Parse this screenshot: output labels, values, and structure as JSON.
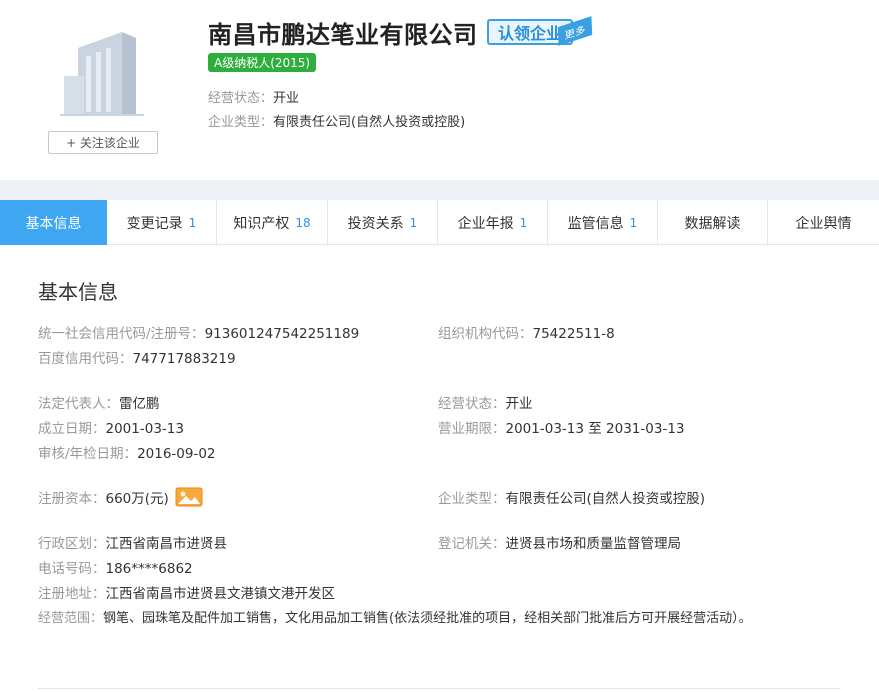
{
  "header": {
    "company_name": "南昌市鹏达笔业有限公司",
    "claim_label": "认领企业",
    "claim_tag": "更多",
    "tax_badge": "A级纳税人(2015)",
    "follow_label": "+ 关注该企业",
    "status_key": "经营状态：",
    "status_value": "开业",
    "type_key": "企业类型：",
    "type_value": "有限责任公司(自然人投资或控股)"
  },
  "tabs": [
    {
      "label": "基本信息",
      "count": ""
    },
    {
      "label": "变更记录",
      "count": "1"
    },
    {
      "label": "知识产权",
      "count": "18"
    },
    {
      "label": "投资关系",
      "count": "1"
    },
    {
      "label": "企业年报",
      "count": "1"
    },
    {
      "label": "监管信息",
      "count": "1"
    },
    {
      "label": "数据解读",
      "count": ""
    },
    {
      "label": "企业舆情",
      "count": ""
    }
  ],
  "section_title": "基本信息",
  "fields": {
    "credit_code": {
      "k": "统一社会信用代码/注册号：",
      "v": "913601247542251189"
    },
    "org_code": {
      "k": "组织机构代码：",
      "v": "75422511-8"
    },
    "baidu_code": {
      "k": "百度信用代码：",
      "v": "747717883219"
    },
    "legal_rep": {
      "k": "法定代表人：",
      "v": "雷亿鹏"
    },
    "biz_status": {
      "k": "经营状态：",
      "v": "开业"
    },
    "founded": {
      "k": "成立日期：",
      "v": "2001-03-13"
    },
    "term": {
      "k": "营业期限：",
      "v": "2001-03-13 至 2031-03-13"
    },
    "approved": {
      "k": "审核/年检日期：",
      "v": "2016-09-02"
    },
    "capital": {
      "k": "注册资本：",
      "v": "660万(元)"
    },
    "ent_type": {
      "k": "企业类型：",
      "v": "有限责任公司(自然人投资或控股)"
    },
    "region": {
      "k": "行政区划：",
      "v": "江西省南昌市进贤县"
    },
    "authority": {
      "k": "登记机关：",
      "v": "进贤县市场和质量监督管理局"
    },
    "phone": {
      "k": "电话号码：",
      "v": "186****6862"
    },
    "address": {
      "k": "注册地址：",
      "v": "江西省南昌市进贤县文港镇文港开发区"
    },
    "scope": {
      "k": "经营范围：",
      "v": "钢笔、园珠笔及配件加工销售，文化用品加工销售(依法须经批准的项目，经相关部门批准后方可开展经营活动）。"
    }
  },
  "colors": {
    "accent": "#3fa7f1",
    "tax_green": "#2fae3e",
    "count_blue": "#3a8ee6",
    "claim_blue": "#3aa0e2"
  }
}
